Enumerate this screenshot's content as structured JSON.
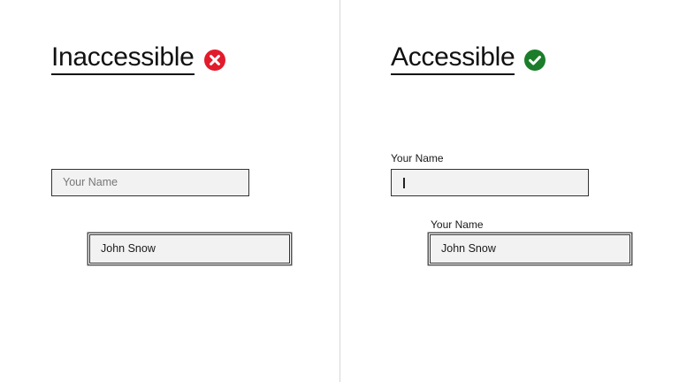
{
  "left_panel": {
    "heading": "Inaccessible",
    "status_icon": "error-x-icon",
    "status_color": "#e21b2c",
    "fields": [
      {
        "value": "",
        "placeholder": "Your Name"
      },
      {
        "value": "John Snow"
      }
    ]
  },
  "right_panel": {
    "heading": "Accessible",
    "status_icon": "check-icon",
    "status_color": "#1b7d2a",
    "fields": [
      {
        "label": "Your Name",
        "value": ""
      },
      {
        "label": "Your Name",
        "value": "John Snow"
      }
    ]
  }
}
